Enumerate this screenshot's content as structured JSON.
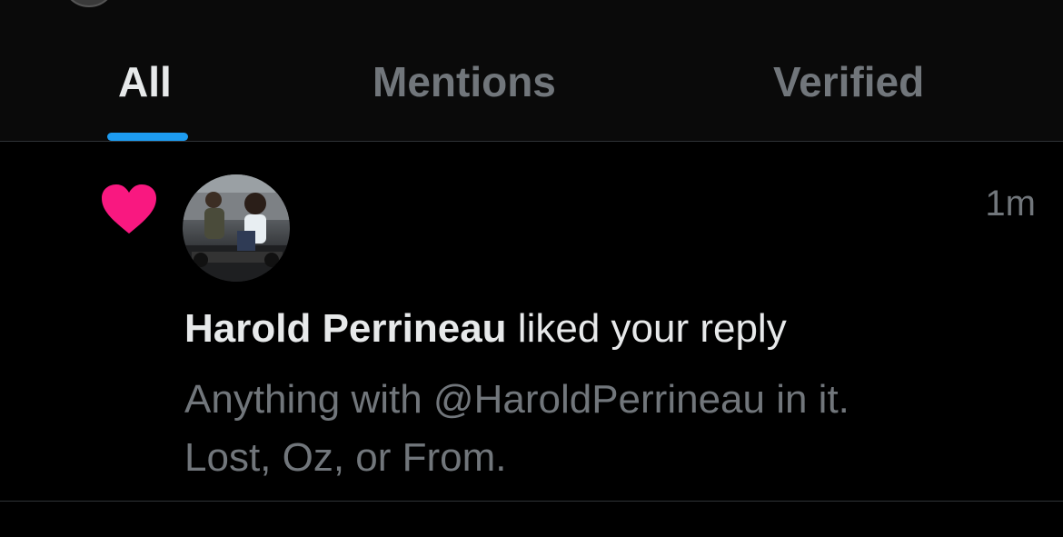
{
  "tabs": {
    "all": "All",
    "mentions": "Mentions",
    "verified": "Verified",
    "active": "All"
  },
  "notification": {
    "user_name": "Harold Perrineau",
    "action_text": "liked your reply",
    "timestamp": "1m",
    "reply_line_1": "Anything with @HaroldPerrineau in it.",
    "reply_line_2": "Lost, Oz, or From.",
    "icon": "heart-icon",
    "icon_color": "#f91880"
  },
  "colors": {
    "accent": "#1d9bf0",
    "background": "#000000",
    "secondary_text": "#71767b",
    "primary_text": "#e7e9ea"
  }
}
